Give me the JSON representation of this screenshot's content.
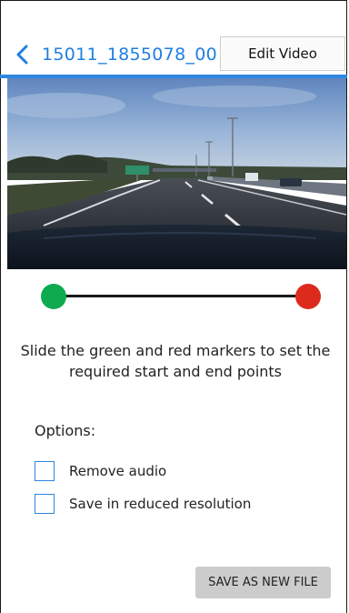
{
  "header": {
    "back_icon": "chevron-left-icon",
    "file_title": "15011_1855078_00",
    "edit_video_label": "Edit Video"
  },
  "video": {
    "description_icon": "video-frame"
  },
  "trim_slider": {
    "start_marker_color": "#0eaa4f",
    "end_marker_color": "#dc2a1c",
    "track_color": "#1a1a1a"
  },
  "instructions": "Slide the green and red markers to set the required start and end points",
  "options": {
    "label": "Options:",
    "items": [
      {
        "label": "Remove audio",
        "checked": false
      },
      {
        "label": "Save in reduced resolution",
        "checked": false
      }
    ]
  },
  "save_button_label": "SAVE AS NEW FILE",
  "colors": {
    "accent": "#2e86e0",
    "title": "#1e7fe0"
  }
}
